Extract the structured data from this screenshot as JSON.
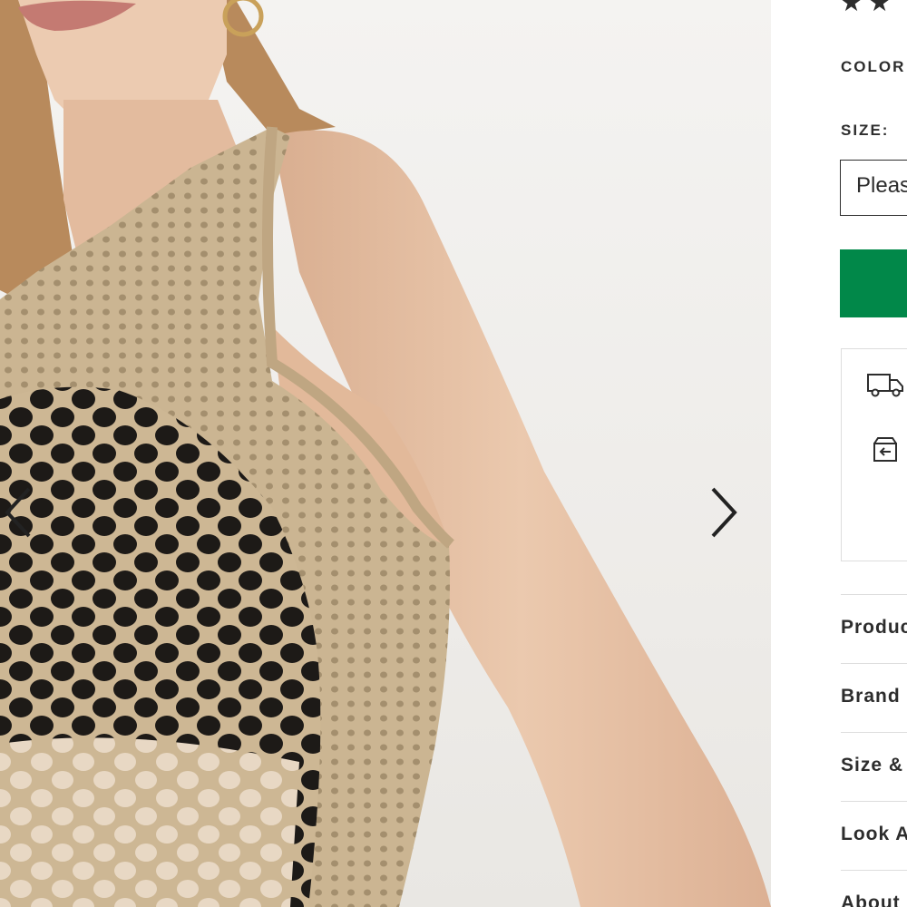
{
  "gallery": {
    "prev_label": "Previous image",
    "next_label": "Next image",
    "image_alt": "Model wearing beige crochet knit sleeveless tank top"
  },
  "product": {
    "rating_stars": "★★",
    "colour_label": "COLOR",
    "size_label": "SIZE:",
    "size_placeholder": "Please select"
  },
  "delivery": {
    "icons": [
      "truck-icon",
      "returns-icon"
    ]
  },
  "accordion": {
    "items": [
      {
        "label": "Product Details"
      },
      {
        "label": "Brand"
      },
      {
        "label": "Size & Fit"
      },
      {
        "label": "Look After Me"
      },
      {
        "label": "About Me"
      }
    ]
  },
  "colors": {
    "add_to_bag": "#018849",
    "text": "#2d2d2d",
    "border": "#dddddd",
    "knit": "#cdb794",
    "skin": "#e6c2a6"
  }
}
